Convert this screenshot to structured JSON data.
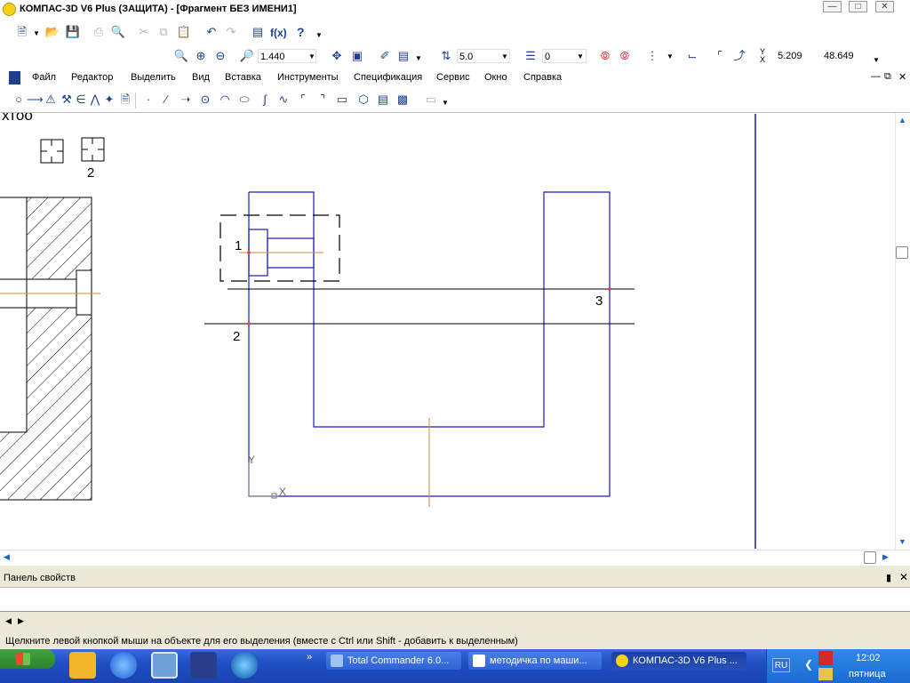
{
  "window": {
    "title": "КОМПАС-3D V6 Plus (ЗАЩИТА) - [Фрагмент БЕЗ ИМЕНИ1]",
    "controls": [
      "minimize",
      "maximize",
      "close"
    ]
  },
  "toolbar1": {
    "view_scale": "1.440",
    "step": "5.0",
    "layer": "0",
    "cursor_x_label": "X",
    "cursor_y_label": "Y",
    "coord_x": "5.209",
    "coord_y": "48.649",
    "fx_label": "f(x)",
    "help_label": "?"
  },
  "menu": {
    "items": [
      "Файл",
      "Редактор",
      "Выделить",
      "Вид",
      "Вставка",
      "Инструменты",
      "Спецификация",
      "Сервис",
      "Окно",
      "Справка"
    ]
  },
  "drawing": {
    "top_text": "хтоо",
    "label_point_2_top": "2",
    "label_1": "1",
    "label_2": "2",
    "label_3": "3",
    "axis_y": "Y",
    "axis_x": "X",
    "colors": {
      "geometry": "#1b1bb0",
      "axis": "#d08a28",
      "aux": "#000000",
      "point": "#e04040"
    }
  },
  "properties_panel": {
    "title": "Панель свойств"
  },
  "status": {
    "text": "Щелкните левой кнопкой мыши на объекте для его выделения (вместе с Ctrl или Shift - добавить к выделенным)"
  },
  "taskbar": {
    "tasks": [
      "Total Commander 6.0...",
      "методичка по маши...",
      "КОМПАС-3D V6 Plus ..."
    ],
    "language": "RU",
    "time": "12:02",
    "day": "пятница"
  }
}
